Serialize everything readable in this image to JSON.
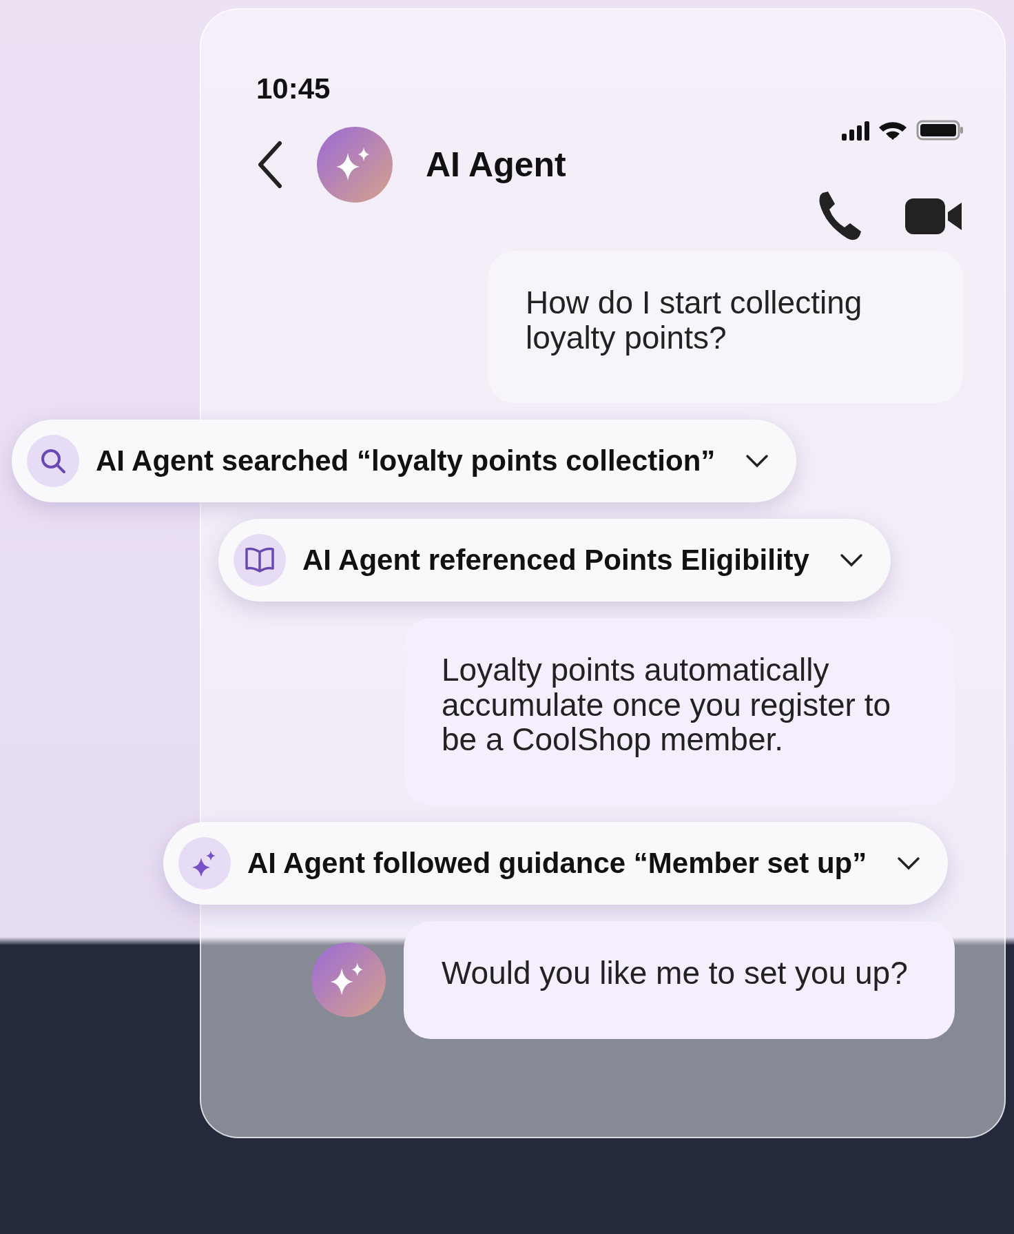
{
  "status_bar": {
    "time": "10:45"
  },
  "header": {
    "title": "AI Agent"
  },
  "messages": [
    {
      "kind": "user",
      "text": "How do I start collecting loyalty points?"
    },
    {
      "kind": "search",
      "text": "AI Agent searched “loyalty points collection”"
    },
    {
      "kind": "reference",
      "text": "AI Agent referenced Points Eligibility"
    },
    {
      "kind": "agent",
      "avatar": false,
      "text": "Loyalty points automatically accumulate once you register to be a CoolShop member."
    },
    {
      "kind": "guidance",
      "text": "AI Agent followed guidance “Member set up”"
    },
    {
      "kind": "agent",
      "avatar": true,
      "text": "Would you like me to set you up?"
    }
  ]
}
